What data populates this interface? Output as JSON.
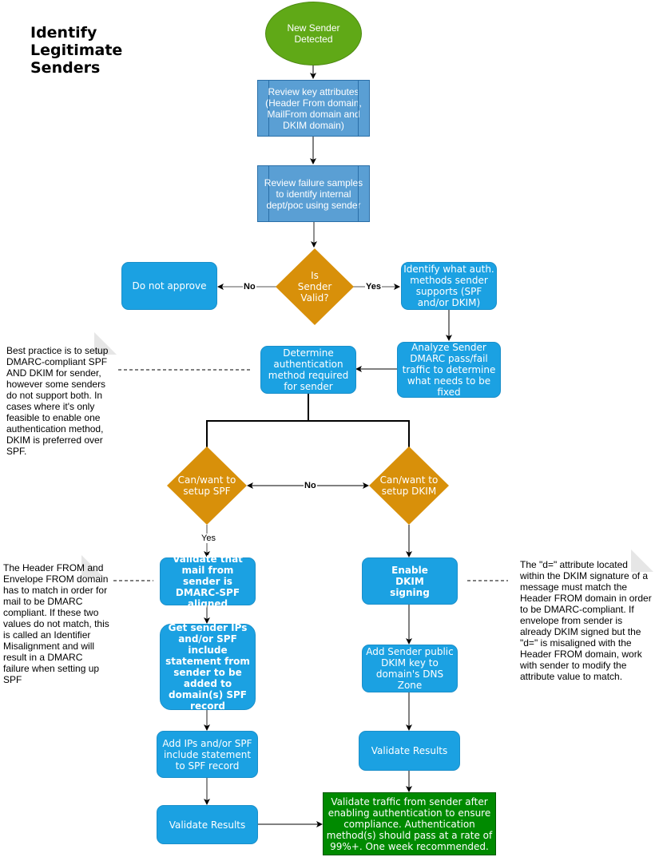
{
  "title": "Identify\nLegitimate\nSenders",
  "title_lines": [
    "Identify",
    "Legitimate",
    "Senders"
  ],
  "colors": {
    "start": "#60a917",
    "process": "#5a9fd4",
    "step": "#1ba1e2",
    "decision": "#d8900a",
    "final": "#008a00",
    "note_fold": "#e6e6e6"
  },
  "nodes": {
    "start": "New Sender Detected",
    "review_attributes": "Review key attributes (Header From domain, MailFrom domain and DKIM domain)",
    "review_failures": "Review failure samples to identify internal dept/poc using sender",
    "is_valid": "Is Sender Valid?",
    "do_not_approve": "Do not approve",
    "identify_methods": "Identify what auth. methods sender supports (SPF and/or DKIM)",
    "analyze_traffic": "Analyze Sender DMARC pass/fail traffic to determine what needs to be fixed",
    "determine_method": "Determine authentication method required for sender",
    "can_spf": "Can/want to setup SPF",
    "can_dkim": "Can/want to setup DKIM",
    "validate_spf_aligned": "Validate that mail from sender is DMARC-SPF aligned",
    "get_sender_ips": "Get sender IPs and/or SPF include statement from sender to be added to domain(s) SPF record",
    "add_ips": "Add IPs and/or SPF include statement to SPF record",
    "validate_results_spf": "Validate Results",
    "enable_dkim": "Enable DKIM signing",
    "add_dkim_key": "Add Sender public DKIM key to domain's DNS Zone",
    "validate_results_dkim": "Validate Results",
    "final_validate": "Validate traffic from sender after enabling authentication to ensure compliance. Authentication method(s) should pass at a rate of 99%+. One week recommended."
  },
  "edge_labels": {
    "no_valid": "No",
    "yes_valid": "Yes",
    "no_between": "No",
    "yes_spf": "Yes"
  },
  "notes": {
    "best_practice": "Best practice is to setup DMARC-compliant SPF AND DKIM for sender, however some senders do not support both. In cases where it's only feasible to enable one authentication method, DKIM is preferred over SPF.",
    "header_from": "The Header FROM and Envelope FROM domain has to match in order for mail to be DMARC compliant. If these two values do not match, this is called an Identifier Misalignment and will result in a DMARC failure when setting up SPF",
    "dkim_d": "The \"d=\" attribute located within the DKIM signature of a message must match the Header FROM domain in order to be DMARC-compliant. If envelope from sender is already DKIM signed but the \"d=\" is misaligned with the Header FROM domain, work with sender to modify the attribute value to match."
  }
}
